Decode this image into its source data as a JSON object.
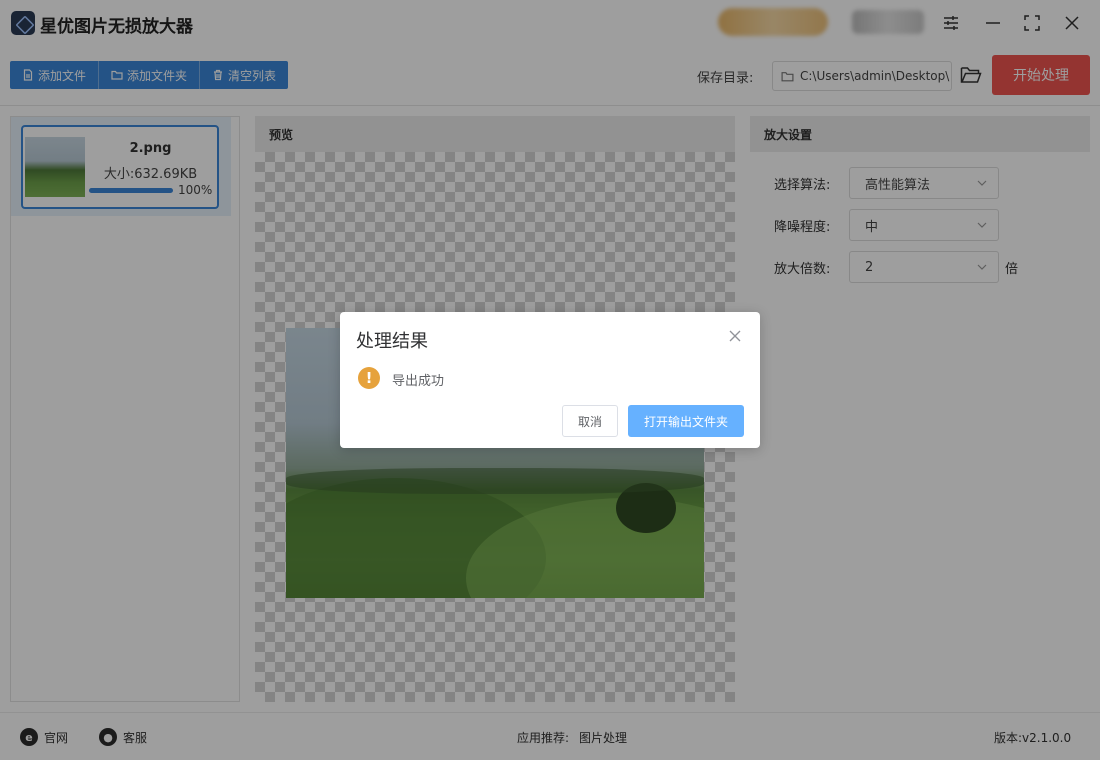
{
  "app": {
    "title": "星优图片无损放大器"
  },
  "toolbar": {
    "add_file": "添加文件",
    "add_folder": "添加文件夹",
    "clear_list": "清空列表",
    "save_label": "保存目录:",
    "save_path": "C:\\Users\\admin\\Desktop\\",
    "start_button": "开始处理"
  },
  "file_list": [
    {
      "name": "2.png",
      "size": "大小:632.69KB",
      "progress_text": "100%",
      "progress": 1.0
    }
  ],
  "preview": {
    "header": "预览"
  },
  "settings": {
    "header": "放大设置",
    "algorithm_label": "选择算法:",
    "algorithm_value": "高性能算法",
    "noise_label": "降噪程度:",
    "noise_value": "中",
    "scale_label": "放大倍数:",
    "scale_value": "2",
    "scale_unit": "倍"
  },
  "footer": {
    "website": "官网",
    "support": "客服",
    "recommend_label": "应用推荐:",
    "recommend_item": "图片处理",
    "version": "版本:v2.1.0.0"
  },
  "dialog": {
    "title": "处理结果",
    "message": "导出成功",
    "cancel": "取消",
    "open_folder": "打开输出文件夹"
  },
  "colors": {
    "primary": "#3a87d8",
    "start_button": "#ef5550",
    "dialog_primary": "#66b1ff",
    "warning": "#e6a23c"
  },
  "icons": {
    "window": [
      "settings-sliders-icon",
      "minimize-icon",
      "maximize-icon",
      "close-icon"
    ],
    "toolbar": [
      "file-icon",
      "folder-icon",
      "trash-icon",
      "folder-open-icon"
    ],
    "footer": [
      "ie-icon",
      "chat-icon"
    ],
    "dialog": [
      "warning-icon",
      "close-icon"
    ]
  }
}
